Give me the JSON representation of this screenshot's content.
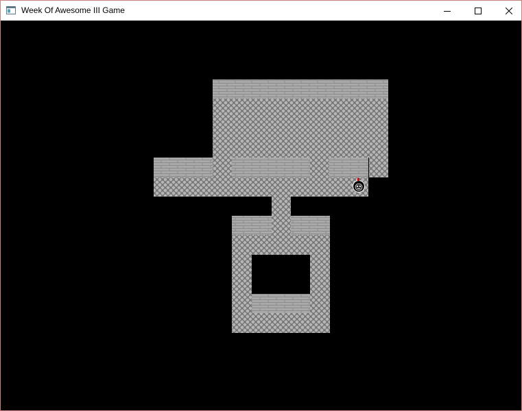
{
  "window": {
    "title": "Week Of Awesome III Game",
    "icon": "app-window-icon",
    "controls": {
      "minimize_icon": "minimize-icon",
      "maximize_icon": "maximize-icon",
      "close_icon": "close-icon"
    }
  },
  "game": {
    "background_color": "#000000",
    "floor_color": "#8c8c8c",
    "wall_color": "#a9a9a9",
    "player_icon": "player-sprite-icon",
    "player_accent_color": "#d01010"
  }
}
